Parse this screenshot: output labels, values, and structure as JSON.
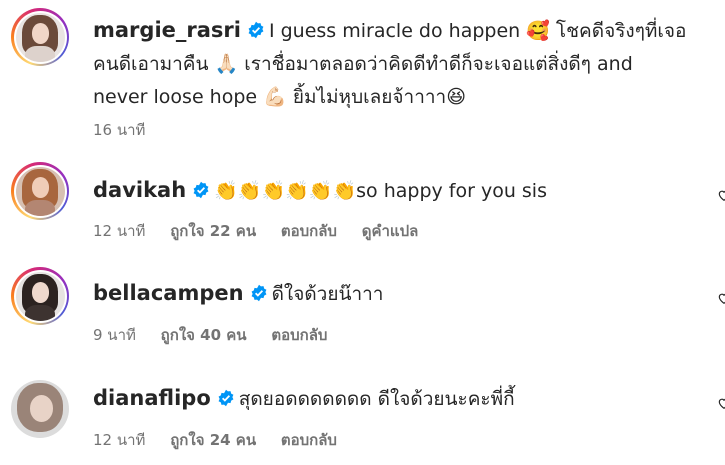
{
  "comments": [
    {
      "username": "margie_rasri",
      "text_line1": "I guess miracle do happen 🥰 โชคดีจริงๆที่เจอ",
      "text_line2": "คนดีเอามาคืน 🙏🏻 เราชื่อมาตลอดว่าคิดดีทำดีก็จะเจอแต่สิ่งดีๆ and",
      "text_line3": "never loose hope 💪🏻 ยิ้มไม่หุบเลยจ้าาาา😆",
      "time": "16 นาที"
    },
    {
      "username": "davikah",
      "text": "👏👏👏👏👏👏so happy for you sis",
      "time": "12 นาที",
      "likes": "ถูกใจ 22 คน",
      "reply": "ตอบกลับ",
      "translate": "ดูคำแปล"
    },
    {
      "username": "bellacampen",
      "text": "ดีใจด้วยน๊าาา",
      "time": "9 นาที",
      "likes": "ถูกใจ 40 คน",
      "reply": "ตอบกลับ"
    },
    {
      "username": "dianaflipo",
      "text": "สุดยอดดดดดดด ดีใจด้วยนะคะพี่กี้",
      "time": "12 นาที",
      "likes": "ถูกใจ 24 คน",
      "reply": "ตอบกลับ"
    }
  ],
  "icons": {
    "verified": "verified-badge-icon",
    "like": "heart-icon"
  },
  "colors": {
    "verified": "#0095f6",
    "meta": "#737373",
    "text": "#262626"
  }
}
